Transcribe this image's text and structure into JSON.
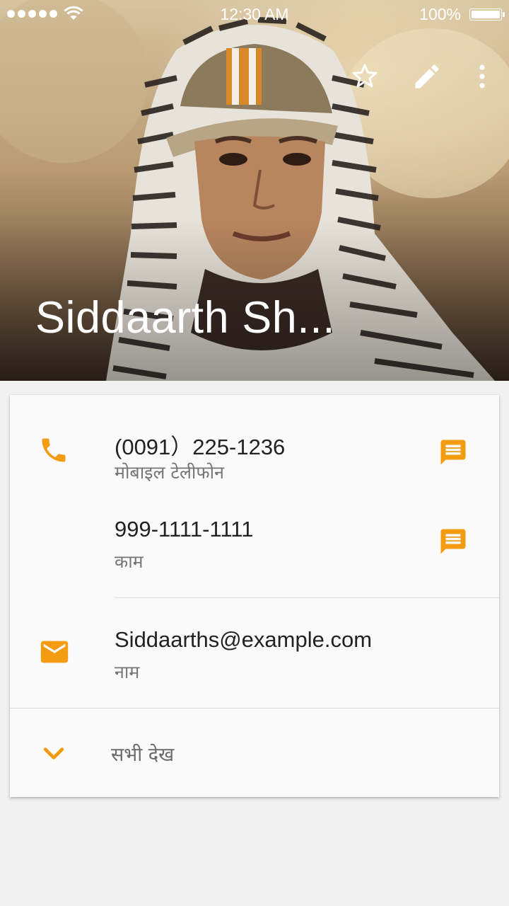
{
  "status_bar": {
    "time": "12:30 AM",
    "battery": "100%"
  },
  "header": {
    "contact_name": "Siddaarth Sh...",
    "actions": {
      "favorite_icon": "star-outline-icon",
      "edit_icon": "pencil-icon",
      "more_icon": "more-vert-icon"
    }
  },
  "colors": {
    "accent": "#f39c12",
    "primary_text": "#222222",
    "secondary_text": "#757575"
  },
  "contact_details": {
    "phones": [
      {
        "number": "(0091）225-1236",
        "type": "मोबाइल टेलीफोन"
      },
      {
        "number": "999-1111-1111",
        "type": "काम"
      }
    ],
    "email": {
      "address": "Siddaarths@example.com",
      "type": "नाम"
    },
    "see_all_label": "सभी देख"
  }
}
